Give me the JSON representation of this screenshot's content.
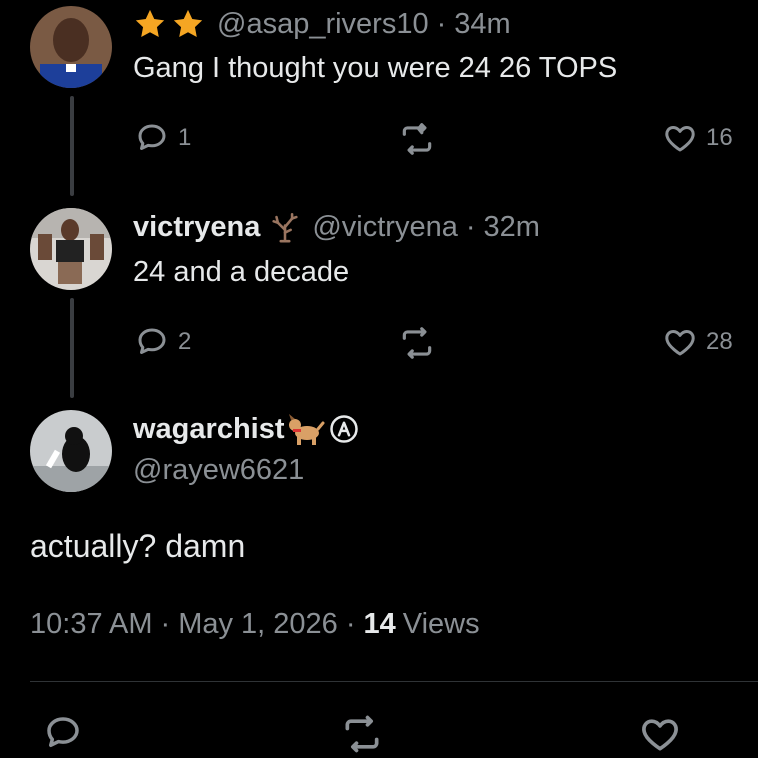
{
  "colors": {
    "background": "#000000",
    "text": "#e7e9ea",
    "muted": "#8b9095",
    "star": "#f5a623",
    "line": "#3a3d41"
  },
  "reply1": {
    "badge_icons": [
      "star-icon",
      "star-icon"
    ],
    "handle": "@asap_rivers10",
    "separator": "·",
    "time": "34m",
    "text": "Gang I thought you were 24 26 TOPS",
    "replies": "1",
    "likes": "16"
  },
  "reply2": {
    "name": "victryena",
    "name_icon": "bare-tree-icon",
    "handle": "@victryena",
    "separator": "·",
    "time": "32m",
    "text": "24 and a decade",
    "replies": "2",
    "likes": "28"
  },
  "main_post": {
    "name": "wagarchist",
    "name_icons": [
      "dog-emoji-icon",
      "circled-a-icon"
    ],
    "handle": "@rayew6621",
    "text": "actually? damn",
    "time": "10:37 AM",
    "separator": "·",
    "date": "May 1, 2026",
    "views_count": "14",
    "views_label": "Views"
  }
}
